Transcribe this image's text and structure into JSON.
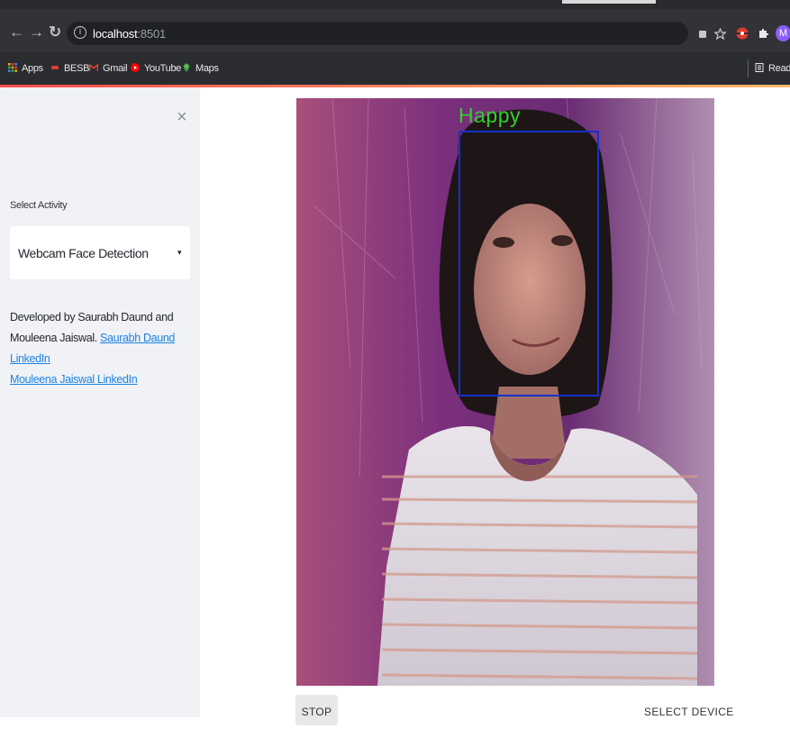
{
  "browser": {
    "url_host": "localhost",
    "url_port": ":8501",
    "bookmarks": [
      {
        "label": "Apps",
        "icon": "apps-grid-icon",
        "color": "#f4b400"
      },
      {
        "label": "BESB",
        "icon": "besb-icon",
        "color": "#e33b2e"
      },
      {
        "label": "Gmail",
        "icon": "gmail-icon",
        "color": "#ea4335"
      },
      {
        "label": "YouTube",
        "icon": "youtube-icon",
        "color": "#ff0000"
      },
      {
        "label": "Maps",
        "icon": "maps-pin-icon",
        "color": "#34a853"
      }
    ],
    "reading_list": "Readin",
    "profile_initial": "M"
  },
  "sidebar": {
    "close_icon": "×",
    "select_label": "Select Activity",
    "select_value": "Webcam Face Detection",
    "caret": "▾",
    "developed_text": "Developed by Saurabh Daund and Mouleena Jaiswal.",
    "link1": "Saurabh Daund LinkedIn",
    "link2": "Mouleena Jaiswal LinkedIn"
  },
  "main": {
    "menu_icon": "⋮",
    "emotion_label": "Happy",
    "stop_label": "STOP",
    "select_device_label": "SELECT DEVICE"
  },
  "colors": {
    "accent_link": "#1c83e1",
    "face_box": "#1232c8",
    "emotion_text": "#31d02a",
    "sidebar_bg": "#f0f2f6"
  }
}
